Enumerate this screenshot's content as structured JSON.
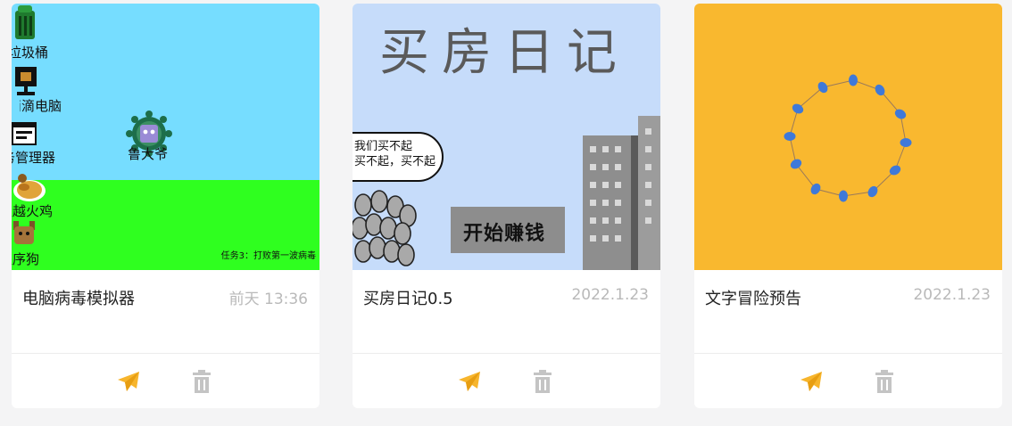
{
  "cards": [
    {
      "title": "电脑病毒模拟器",
      "date": "前天 13:36",
      "thumb": {
        "labels": [
          "垃圾桶",
          "滴滴电脑",
          "任务管理器",
          "超越火鸡",
          "程序狗",
          "鲁大爷"
        ],
        "task": "任务3：打败第一波病毒"
      }
    },
    {
      "title": "买房日记0.5",
      "date": "2022.1.23",
      "thumb": {
        "heading": "买房日记",
        "bubble_line1": "我们买不起",
        "bubble_line2": "买不起，买不起",
        "sign": "开始赚钱"
      }
    },
    {
      "title": "文字冒险预告",
      "date": "2022.1.23",
      "thumb": {}
    }
  ],
  "icons": {
    "share": "paper-plane-icon",
    "delete": "trash-icon"
  },
  "colors": {
    "accent": "#f7b52c",
    "muted_icon": "#c4c4c4",
    "date_text": "#b9b9b9"
  }
}
